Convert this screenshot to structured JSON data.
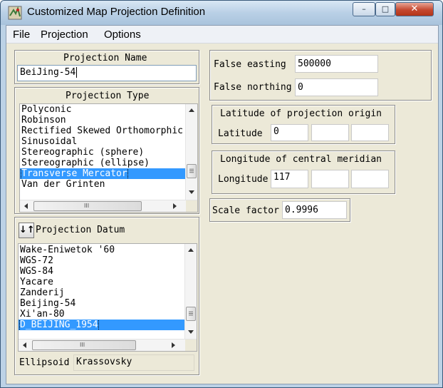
{
  "window": {
    "title": "Customized Map Projection Definition",
    "minimize": "–",
    "maximize": "□",
    "close": "✕"
  },
  "menu": [
    "File",
    "Projection",
    "Options"
  ],
  "projection_name": {
    "label": "Projection Name",
    "value": "BeiJing-54"
  },
  "projection_type": {
    "label": "Projection Type",
    "items": [
      "Polyconic",
      "Robinson",
      "Rectified Skewed Orthomorphic",
      "Sinusoidal",
      "Stereographic (sphere)",
      "Stereographic (ellipse)",
      "Transverse Mercator",
      "Van der Grinten"
    ],
    "selected": "Transverse Mercator"
  },
  "datum": {
    "label": "Projection Datum",
    "sort_icon": "↓↑",
    "items": [
      "Wake-Eniwetok '60",
      "WGS-72",
      "WGS-84",
      "Yacare",
      "Zanderij",
      "Beijing-54",
      "Xi'an-80",
      "D_BEIJING_1954"
    ],
    "selected": "D_BEIJING_1954",
    "ellipsoid_label": "Ellipsoid",
    "ellipsoid_value": "Krassovsky"
  },
  "false_easting": {
    "label": "False easting",
    "value": "500000"
  },
  "false_northing": {
    "label": "False northing",
    "value": "0"
  },
  "latitude_origin": {
    "title": "Latitude of projection origin",
    "label": "Latitude",
    "deg": "0",
    "min": "",
    "sec": ""
  },
  "central_meridian": {
    "title": "Longitude of central meridian",
    "label": "Longitude",
    "deg": "117",
    "min": "",
    "sec": ""
  },
  "scale_factor": {
    "label": "Scale factor",
    "value": "0.9996"
  },
  "scroll_grip": "III",
  "colors": {
    "selection": "#3399ff",
    "titlebar": "#b9d0e6",
    "dialog": "#ece9d8"
  }
}
